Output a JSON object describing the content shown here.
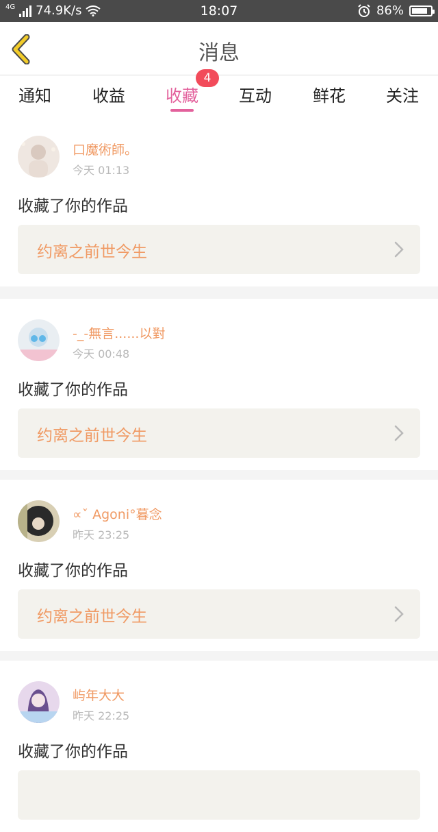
{
  "status_bar": {
    "network_type": "4G",
    "speed": "74.9K/s",
    "time": "18:07",
    "battery_percent": "86%",
    "battery_level": 0.86
  },
  "nav": {
    "title": "消息",
    "back_icon": "chevron-left-icon"
  },
  "tabs": [
    {
      "label": "通知"
    },
    {
      "label": "收益"
    },
    {
      "label": "收藏",
      "badge": "4",
      "active": true
    },
    {
      "label": "互动"
    },
    {
      "label": "鲜花"
    },
    {
      "label": "关注"
    }
  ],
  "messages": [
    {
      "username": "口魔術師。",
      "time": "今天 01:13",
      "action": "收藏了你的作品",
      "work_title": "约离之前世今生"
    },
    {
      "username": "-_-無言......以對",
      "time": "今天 00:48",
      "action": "收藏了你的作品",
      "work_title": "约离之前世今生"
    },
    {
      "username": "∝ˇ  Agoni°暮念",
      "time": "昨天 23:25",
      "action": "收藏了你的作品",
      "work_title": "约离之前世今生"
    },
    {
      "username": "屿年大大",
      "time": "昨天 22:25",
      "action": "收藏了你的作品",
      "work_title": ""
    }
  ],
  "colors": {
    "accent": "#e3619c",
    "username": "#f09a64",
    "badge": "#f24b5a",
    "back_icon": "#f2cc2a"
  }
}
